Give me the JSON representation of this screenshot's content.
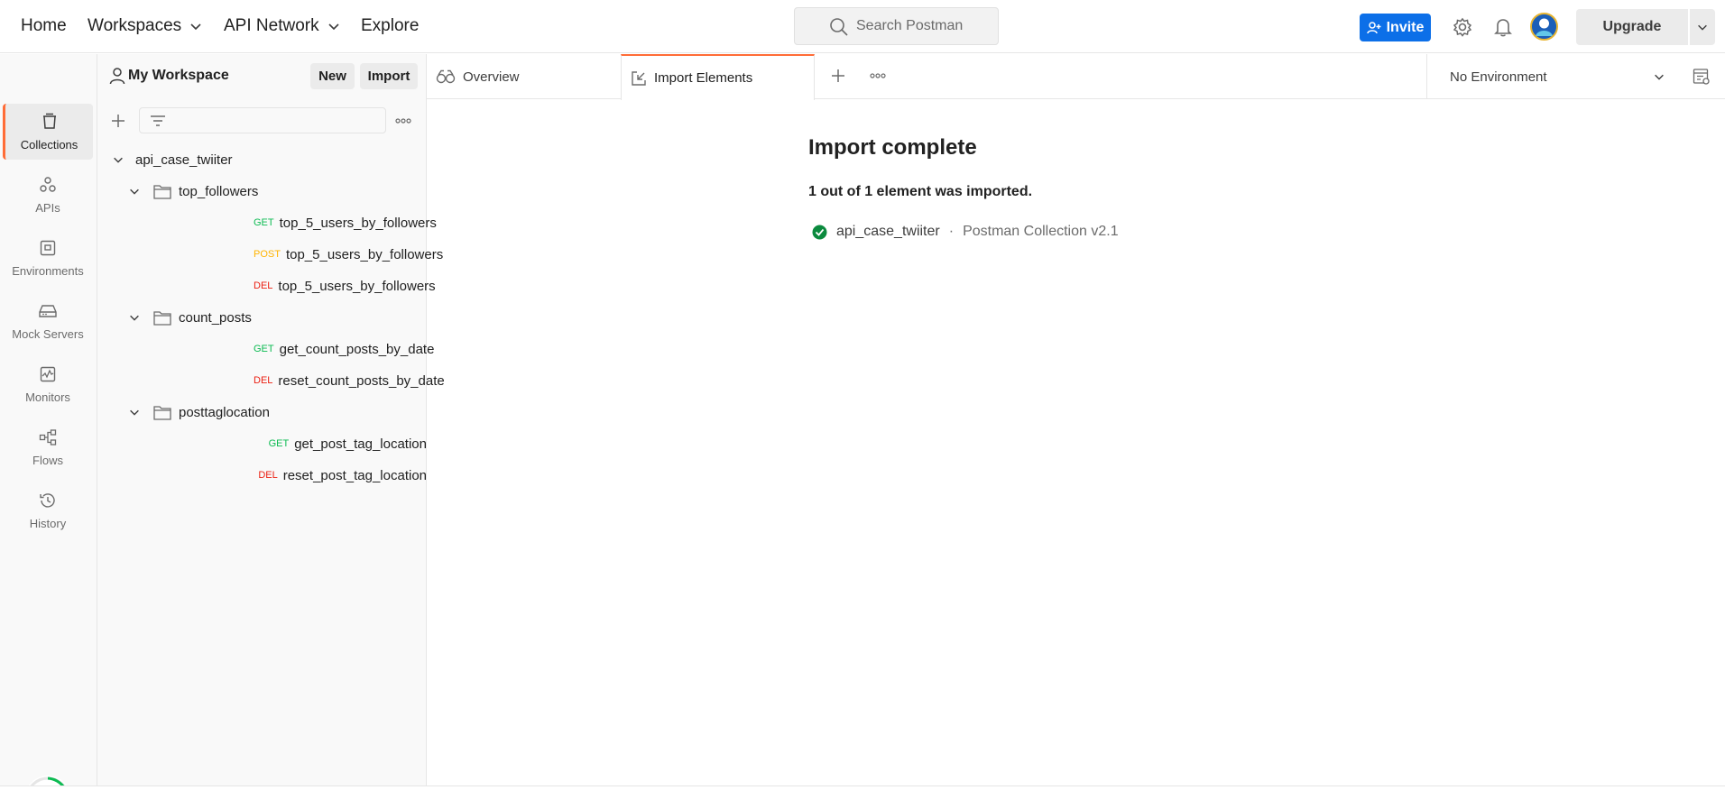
{
  "topbar": {
    "nav": [
      {
        "label": "Home",
        "dropdown": false
      },
      {
        "label": "Workspaces",
        "dropdown": true
      },
      {
        "label": "API Network",
        "dropdown": true
      },
      {
        "label": "Explore",
        "dropdown": false
      }
    ],
    "search_placeholder": "Search Postman",
    "invite_label": "Invite",
    "upgrade_label": "Upgrade"
  },
  "rail": {
    "items": [
      {
        "label": "Collections",
        "icon": "collections-icon",
        "active": true
      },
      {
        "label": "APIs",
        "icon": "apis-icon",
        "active": false
      },
      {
        "label": "Environments",
        "icon": "environments-icon",
        "active": false
      },
      {
        "label": "Mock Servers",
        "icon": "mock-servers-icon",
        "active": false
      },
      {
        "label": "Monitors",
        "icon": "monitors-icon",
        "active": false
      },
      {
        "label": "Flows",
        "icon": "flows-icon",
        "active": false
      },
      {
        "label": "History",
        "icon": "history-icon",
        "active": false
      }
    ]
  },
  "workspace": {
    "title": "My Workspace",
    "new_label": "New",
    "import_label": "Import",
    "collection": {
      "name": "api_case_twiiter",
      "folders": [
        {
          "name": "top_followers",
          "requests": [
            {
              "method": "GET",
              "name": "top_5_users_by_followers"
            },
            {
              "method": "POST",
              "name": "top_5_users_by_followers"
            },
            {
              "method": "DEL",
              "name": "top_5_users_by_followers"
            }
          ]
        },
        {
          "name": "count_posts",
          "requests": [
            {
              "method": "GET",
              "name": "get_count_posts_by_date"
            },
            {
              "method": "DEL",
              "name": "reset_count_posts_by_date"
            }
          ]
        },
        {
          "name": "posttaglocation",
          "requests": [
            {
              "method": "GET",
              "name": "get_post_tag_location"
            },
            {
              "method": "DEL",
              "name": "reset_post_tag_location"
            }
          ]
        }
      ]
    }
  },
  "tabs": {
    "items": [
      {
        "label": "Overview",
        "active": false
      },
      {
        "label": "Import Elements",
        "active": true
      }
    ],
    "environment": "No Environment"
  },
  "main": {
    "title": "Import complete",
    "summary": "1 out of 1 element was imported.",
    "imported": {
      "name": "api_case_twiiter",
      "separator": "·",
      "format": "Postman Collection v2.1",
      "status": "success"
    }
  },
  "colors": {
    "accent": "#ff6c37",
    "invite": "#0c6fe8",
    "get": "#0cbb52",
    "post": "#ffb400",
    "del": "#eb2013",
    "success": "#0b8a3e"
  }
}
